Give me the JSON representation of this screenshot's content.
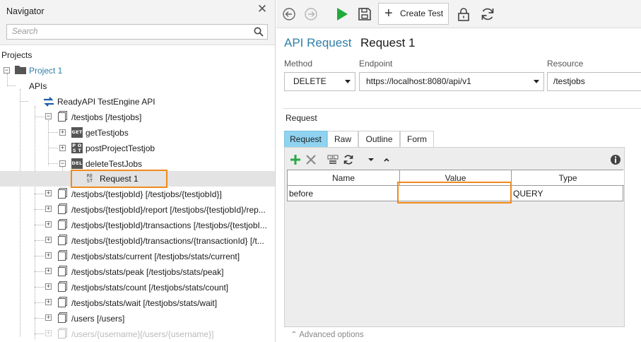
{
  "navigator": {
    "title": "Navigator",
    "close_glyph": "✕",
    "search_placeholder": "Search",
    "projects_label": "Projects",
    "tree": {
      "project": "Project 1",
      "apis": "APIs",
      "api": "ReadyAPI TestEngine API",
      "testjobs": "/testjobs [/testjobs]",
      "get": "getTestjobs",
      "post": "postProjectTestjob",
      "del": "deleteTestJobs",
      "request": "Request 1",
      "resources": [
        "/testjobs/{testjobId} [/testjobs/{testjobId}]",
        "/testjobs/{testjobId}/report [/testjobs/{testjobId}/rep...",
        "/testjobs/{testjobId}/transactions [/testjobs/{testjobI...",
        "/testjobs/{testjobId}/transactions/{transactionId} [/t...",
        "/testjobs/stats/current [/testjobs/stats/current]",
        "/testjobs/stats/peak [/testjobs/stats/peak]",
        "/testjobs/stats/count [/testjobs/stats/count]",
        "/testjobs/stats/wait [/testjobs/stats/wait]",
        "/users [/users]",
        "/users/{username}[/users/{username}]"
      ]
    },
    "badges": {
      "get": "GET",
      "post_top": "P O",
      "post_bottom": "S T",
      "del": "DEL",
      "rest_top": "RE",
      "rest_bottom": "ST"
    }
  },
  "toolbar": {
    "create_test_label": "Create Test"
  },
  "request": {
    "kind": "API Request",
    "name": "Request 1",
    "method_label": "Method",
    "method_value": "DELETE",
    "endpoint_label": "Endpoint",
    "endpoint_value": "https://localhost:8080/api/v1",
    "resource_label": "Resource",
    "resource_value": "/testjobs",
    "section_label": "Request",
    "tabs": [
      "Request",
      "Raw",
      "Outline",
      "Form"
    ],
    "grid": {
      "headers": [
        "Name",
        "Value",
        "Type"
      ],
      "rows": [
        {
          "name": "before",
          "value": "",
          "type": "QUERY"
        }
      ]
    },
    "advanced_label": "Advanced options"
  },
  "colors": {
    "accent_title": "#2f7fa8",
    "active_tab": "#8fd3f0",
    "highlight": "#f08a1c",
    "run_green": "#1faa3a",
    "add_green": "#2aa84a"
  }
}
